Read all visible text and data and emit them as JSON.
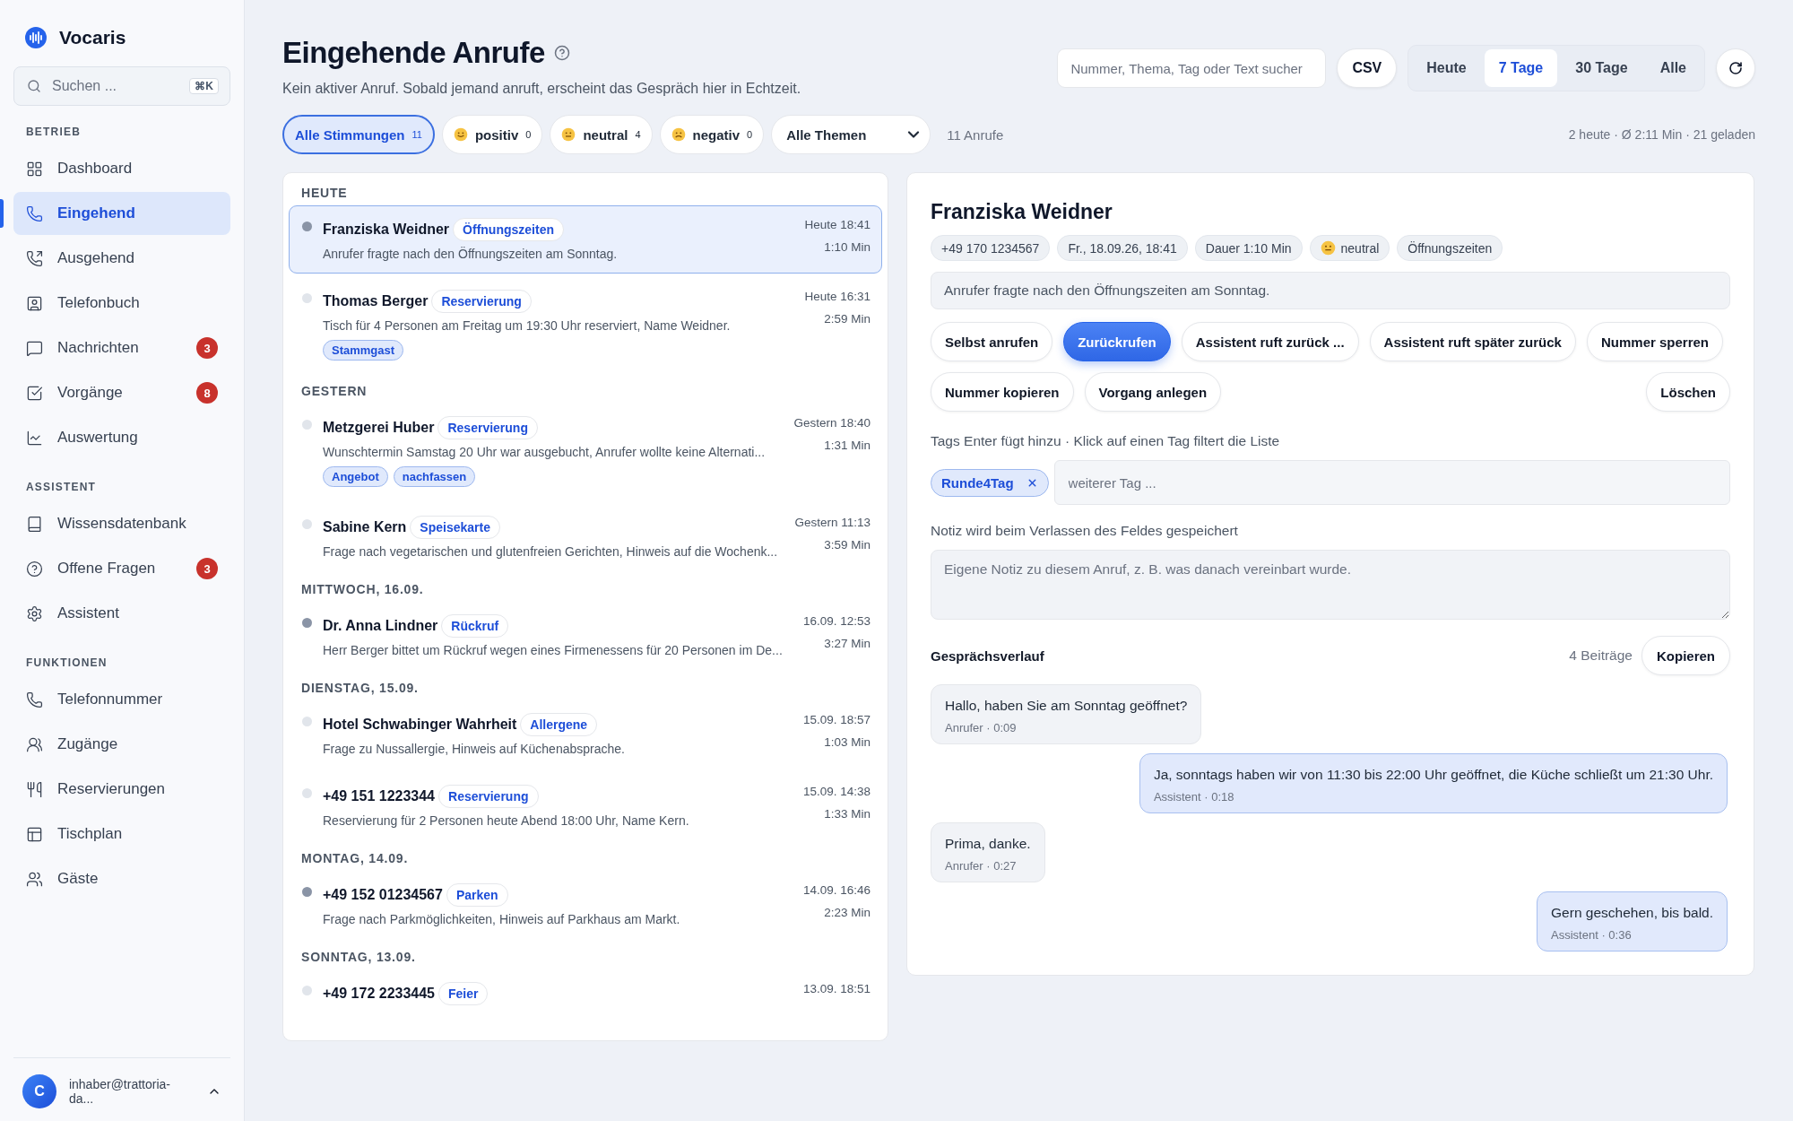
{
  "brand": {
    "name": "Vocaris"
  },
  "sidebar": {
    "search": {
      "placeholder": "Suchen ...",
      "shortcut": "⌘K"
    },
    "sections": [
      {
        "heading": "BETRIEB",
        "items": [
          {
            "label": "Dashboard",
            "selected": false
          },
          {
            "label": "Eingehend",
            "selected": true
          },
          {
            "label": "Ausgehend",
            "selected": false
          },
          {
            "label": "Telefonbuch",
            "selected": false
          },
          {
            "label": "Nachrichten",
            "selected": false,
            "badge": "3"
          },
          {
            "label": "Vorgänge",
            "selected": false,
            "badge": "8"
          },
          {
            "label": "Auswertung",
            "selected": false
          }
        ]
      },
      {
        "heading": "ASSISTENT",
        "items": [
          {
            "label": "Wissensdatenbank",
            "selected": false
          },
          {
            "label": "Offene Fragen",
            "selected": false,
            "badge": "3"
          },
          {
            "label": "Assistent",
            "selected": false
          }
        ]
      },
      {
        "heading": "FUNKTIONEN",
        "items": [
          {
            "label": "Telefonnummer",
            "selected": false
          },
          {
            "label": "Zugänge",
            "selected": false
          },
          {
            "label": "Reservierungen",
            "selected": false
          },
          {
            "label": "Tischplan",
            "selected": false
          },
          {
            "label": "Gäste",
            "selected": false
          }
        ]
      }
    ],
    "user": {
      "initial": "C",
      "email": "inhaber@trattoria-da..."
    }
  },
  "header": {
    "title": "Eingehende Anrufe",
    "subtitle": "Kein aktiver Anruf. Sobald jemand anruft, erscheint das Gespräch hier in Echtzeit.",
    "search": {
      "placeholder": "Nummer, Thema, Tag oder Text sucher"
    },
    "export_button": "CSV",
    "ranges": [
      {
        "label": "Heute",
        "selected": false
      },
      {
        "label": "7 Tage",
        "selected": true
      },
      {
        "label": "30 Tage",
        "selected": false
      },
      {
        "label": "Alle",
        "selected": false
      }
    ]
  },
  "filters": {
    "moods": [
      {
        "label": "Alle Stimmungen",
        "count": "11",
        "kind": "all",
        "selected": true
      },
      {
        "label": "positiv",
        "count": "0",
        "kind": "positive",
        "selected": false
      },
      {
        "label": "neutral",
        "count": "4",
        "kind": "neutral",
        "selected": false
      },
      {
        "label": "negativ",
        "count": "0",
        "kind": "negative",
        "selected": false
      }
    ],
    "topic_select": "Alle Themen",
    "result_count": "11 Anrufe",
    "summary": "2 heute · Ø 2:11 Min · 21 geladen"
  },
  "calls": [
    {
      "heading": "HEUTE",
      "items": [
        {
          "name": "Franziska Weidner",
          "topic": "Öffnungszeiten",
          "summary": "Anrufer fragte nach den Öffnungszeiten am Sonntag.",
          "time": "Heute 18:41",
          "duration": "1:10 Min",
          "unread": true,
          "selected": true
        },
        {
          "name": "Thomas Berger",
          "topic": "Reservierung",
          "summary": "Tisch für 4 Personen am Freitag um 19:30 Uhr reserviert, Name Weidner.",
          "tags": [
            "Stammgast"
          ],
          "time": "Heute 16:31",
          "duration": "2:59 Min",
          "unread": false,
          "selected": false
        }
      ]
    },
    {
      "heading": "GESTERN",
      "items": [
        {
          "name": "Metzgerei Huber",
          "topic": "Reservierung",
          "summary": "Wunschtermin Samstag 20 Uhr war ausgebucht, Anrufer wollte keine Alternati...",
          "tags": [
            "Angebot",
            "nachfassen"
          ],
          "time": "Gestern 18:40",
          "duration": "1:31 Min",
          "unread": false,
          "selected": false
        },
        {
          "name": "Sabine Kern",
          "topic": "Speisekarte",
          "summary": "Frage nach vegetarischen und glutenfreien Gerichten, Hinweis auf die Wochenk...",
          "time": "Gestern 11:13",
          "duration": "3:59 Min",
          "unread": false,
          "selected": false
        }
      ]
    },
    {
      "heading": "MITTWOCH, 16.09.",
      "items": [
        {
          "name": "Dr. Anna Lindner",
          "topic": "Rückruf",
          "summary": "Herr Berger bittet um Rückruf wegen eines Firmenessens für 20 Personen im De...",
          "time": "16.09. 12:53",
          "duration": "3:27 Min",
          "unread": true,
          "selected": false
        }
      ]
    },
    {
      "heading": "DIENSTAG, 15.09.",
      "items": [
        {
          "name": "Hotel Schwabinger Wahrheit",
          "topic": "Allergene",
          "summary": "Frage zu Nussallergie, Hinweis auf Küchenabsprache.",
          "time": "15.09. 18:57",
          "duration": "1:03 Min",
          "unread": false,
          "selected": false
        },
        {
          "name": "+49 151 1223344",
          "topic": "Reservierung",
          "summary": "Reservierung für 2 Personen heute Abend 18:00 Uhr, Name Kern.",
          "time": "15.09. 14:38",
          "duration": "1:33 Min",
          "unread": false,
          "selected": false
        }
      ]
    },
    {
      "heading": "MONTAG, 14.09.",
      "items": [
        {
          "name": "+49 152 01234567",
          "topic": "Parken",
          "summary": "Frage nach Parkmöglichkeiten, Hinweis auf Parkhaus am Markt.",
          "time": "14.09. 16:46",
          "duration": "2:23 Min",
          "unread": true,
          "selected": false
        }
      ]
    },
    {
      "heading": "SONNTAG, 13.09.",
      "items": [
        {
          "name": "+49 172 2233445",
          "topic": "Feier",
          "time": "13.09. 18:51",
          "unread": false,
          "selected": false
        }
      ]
    }
  ],
  "detail": {
    "name": "Franziska Weidner",
    "chips": [
      {
        "kind": "text",
        "label": "+49 170 1234567"
      },
      {
        "kind": "text",
        "label": "Fr., 18.09.26, 18:41"
      },
      {
        "kind": "text",
        "label": "Dauer 1:10 Min"
      },
      {
        "kind": "neutral",
        "label": "neutral"
      },
      {
        "kind": "text",
        "label": "Öffnungszeiten"
      }
    ],
    "summary": "Anrufer fragte nach den Öffnungszeiten am Sonntag.",
    "actions": [
      {
        "label": "Selbst anrufen",
        "primary": false
      },
      {
        "label": "Zurückrufen",
        "primary": true
      },
      {
        "label": "Assistent ruft zurück ...",
        "primary": false
      },
      {
        "label": "Assistent ruft später zurück",
        "primary": false
      },
      {
        "label": "Nummer sperren",
        "primary": false
      },
      {
        "label": "Nummer kopieren",
        "primary": false
      },
      {
        "label": "Vorgang anlegen",
        "primary": false
      }
    ],
    "delete_button": "Löschen",
    "tags_hint": "Tags Enter fügt hinzu · Klick auf einen Tag filtert die Liste",
    "tags": [
      "Runde4Tag"
    ],
    "tag_input": {
      "placeholder": "weiterer Tag ..."
    },
    "note_hint": "Notiz wird beim Verlassen des Feldes gespeichert",
    "note": {
      "placeholder": "Eigene Notiz zu diesem Anruf, z. B. was danach vereinbart wurde."
    },
    "transcript": {
      "title": "Gesprächsverlauf",
      "count": "4 Beiträge",
      "copy_button": "Kopieren",
      "messages": [
        {
          "kind": "caller",
          "text": "Hallo, haben Sie am Sonntag geöffnet?",
          "meta": "Anrufer · 0:09"
        },
        {
          "kind": "assistant",
          "text": "Ja, sonntags haben wir von 11:30 bis 22:00 Uhr geöffnet, die Küche schließt um 21:30 Uhr.",
          "meta": "Assistent · 0:18"
        },
        {
          "kind": "caller",
          "text": "Prima, danke.",
          "meta": "Anrufer · 0:27"
        },
        {
          "kind": "assistant",
          "text": "Gern geschehen, bis bald.",
          "meta": "Assistent · 0:36"
        }
      ]
    }
  }
}
